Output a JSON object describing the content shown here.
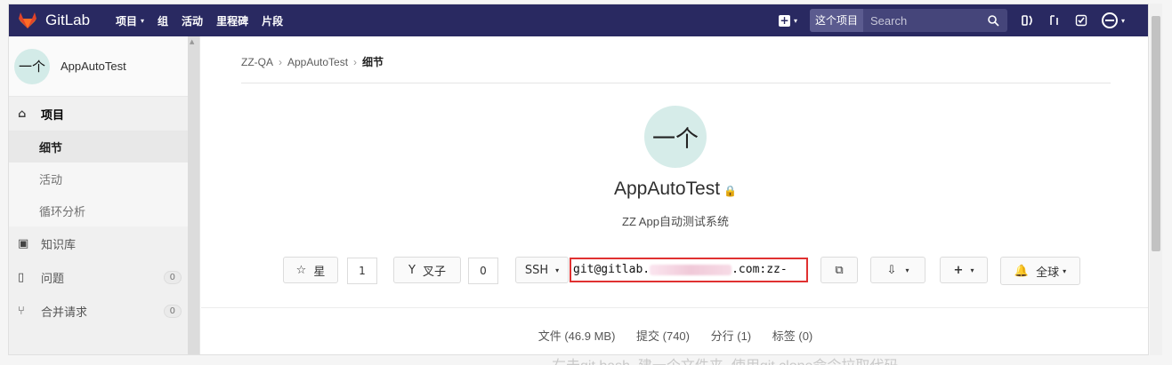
{
  "navbar": {
    "brand": "GitLab",
    "menu": [
      {
        "label": "项目",
        "dropdown": true
      },
      {
        "label": "组",
        "dropdown": false
      },
      {
        "label": "活动",
        "dropdown": false
      },
      {
        "label": "里程碑",
        "dropdown": false
      },
      {
        "label": "片段",
        "dropdown": false
      }
    ],
    "search_scope": "这个项目",
    "search_placeholder": "Search",
    "colors": {
      "navbar_bg": "#292961",
      "logo_orange": "#e24329"
    }
  },
  "sidebar": {
    "project_name": "AppAutoTest",
    "avatar_text": "一个",
    "section": "项目",
    "sub_items": [
      "细节",
      "活动",
      "循环分析"
    ],
    "items": [
      {
        "label": "知识库",
        "icon": "book-icon"
      },
      {
        "label": "问题",
        "icon": "issues-icon",
        "count": "0"
      },
      {
        "label": "合并请求",
        "icon": "merge-request-icon",
        "count": "0"
      }
    ]
  },
  "breadcrumb": {
    "group": "ZZ-QA",
    "project": "AppAutoTest",
    "current": "细节"
  },
  "project": {
    "avatar_text": "一个",
    "title": "AppAutoTest",
    "description": "ZZ App自动测试系统"
  },
  "actions": {
    "star_label": "星",
    "star_count": "1",
    "fork_label": "叉子",
    "fork_count": "0",
    "protocol": "SSH",
    "url_prefix": "git@gitlab.",
    "url_suffix": ".com:zz-",
    "notify_label": "全球"
  },
  "stats": {
    "files": "文件 (46.9 MB)",
    "commits": "提交 (740)",
    "branches": "分行 (1)",
    "tags": "标签 (0)"
  },
  "background_caption": "右击git bash, 建一个文件夹, 使用git clone命令拉取代码"
}
